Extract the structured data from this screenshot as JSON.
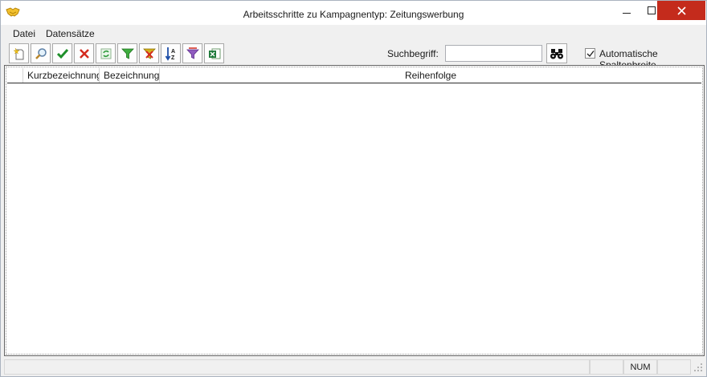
{
  "window": {
    "title": "Arbeitsschritte zu Kampagnentyp: Zeitungswerbung",
    "icon": "handshake-icon",
    "close_color": "#c42b1c"
  },
  "menu": {
    "datei": "Datei",
    "datensaetze": "Datensätze"
  },
  "toolbar": {
    "buttons": [
      {
        "icon": "new-record-icon"
      },
      {
        "icon": "search-magnifier-icon"
      },
      {
        "icon": "confirm-check-icon"
      },
      {
        "icon": "cancel-x-icon"
      },
      {
        "icon": "refresh-icon"
      },
      {
        "icon": "filter-icon"
      },
      {
        "icon": "remove-filter-icon"
      },
      {
        "icon": "sort-az-icon"
      },
      {
        "icon": "filter-options-icon"
      },
      {
        "icon": "excel-export-icon"
      }
    ],
    "search_label": "Suchbegriff:",
    "search_value": "",
    "search_button_icon": "binoculars-icon",
    "auto_column_width_label": "Automatische Spaltenbreite",
    "auto_column_width_checked": true
  },
  "grid": {
    "columns": [
      "Kurzbezeichnung",
      "Bezeichnung",
      "Reihenfolge"
    ],
    "rows": []
  },
  "statusbar": {
    "num": "NUM"
  }
}
